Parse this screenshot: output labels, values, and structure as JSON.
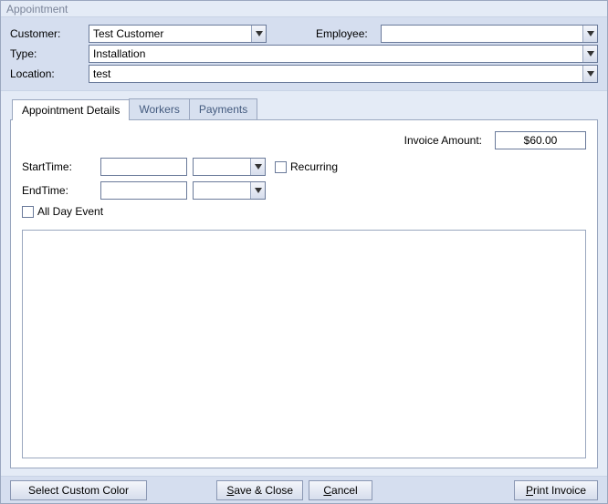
{
  "window": {
    "title": "Appointment"
  },
  "header": {
    "customer_label": "Customer:",
    "customer_value": "Test Customer",
    "employee_label": "Employee:",
    "employee_value": "",
    "type_label": "Type:",
    "type_value": "Installation",
    "location_label": "Location:",
    "location_value": "test"
  },
  "tabs": {
    "items": [
      {
        "label": "Appointment Details",
        "active": true
      },
      {
        "label": "Workers",
        "active": false
      },
      {
        "label": "Payments",
        "active": false
      }
    ]
  },
  "details": {
    "invoice_amount_label": "Invoice Amount:",
    "invoice_amount_value": "$60.00",
    "starttime_label": "StartTime:",
    "starttime_date": "",
    "starttime_time": "",
    "endtime_label": "EndTime:",
    "endtime_date": "",
    "endtime_time": "",
    "recurring_label": "Recurring",
    "recurring_checked": false,
    "allday_label": "All Day Event",
    "allday_checked": false
  },
  "buttons": {
    "select_color": "Select Custom Color",
    "save_close": "Save & Close",
    "cancel": "Cancel",
    "print_invoice": "Print Invoice"
  }
}
